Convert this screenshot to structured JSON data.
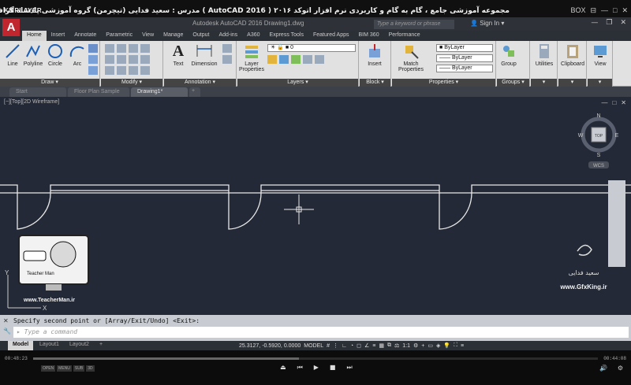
{
  "player": {
    "logo": "KMPLAYER",
    "title": "مجموعه آموزشی جامع ، گام به گام و کاربردی نرم افزار  اتوکد ۲۰۱۶ ( AutoCAD 2016 )  مدرس : سعید فدایی (تیچرمن) گروه آموزشی پادشاه گرافیست ها",
    "right_label": "BOX",
    "time_elapsed": "00:48:23",
    "time_total": "00:44:08",
    "progress": 0.47,
    "small_buttons": [
      "OPEN",
      "MENU",
      "SUB",
      "3D"
    ]
  },
  "acad": {
    "logo_letter": "A",
    "file_title": "Autodesk AutoCAD 2016   Drawing1.dwg",
    "search_placeholder": "Type a keyword or phrase",
    "sign_in": "Sign In",
    "ribbon_tabs": [
      "Home",
      "Insert",
      "Annotate",
      "Parametric",
      "View",
      "Manage",
      "Output",
      "Add-ins",
      "A360",
      "Express Tools",
      "Featured Apps",
      "BIM 360",
      "Performance"
    ],
    "active_tab": "Home",
    "draw_tools": [
      "Line",
      "Polyline",
      "Circle",
      "Arc"
    ],
    "panels": {
      "draw": "Draw",
      "modify": "Modify",
      "annotation": "Annotation",
      "layers": "Layers",
      "block": "Block",
      "properties": "Properties",
      "groups": "Groups"
    },
    "annotation_tools": [
      "Text",
      "Dimension"
    ],
    "layer_tool": "Layer Properties",
    "layer_value": "0",
    "insert_tool": "Insert",
    "match_tool": "Match Properties",
    "bylayer": "ByLayer",
    "group_tool": "Group",
    "utilities": "Utilities",
    "clipboard": "Clipboard",
    "view": "View",
    "doc_tabs": [
      "Start",
      "Floor Plan Sample",
      "Drawing1*"
    ],
    "viewport_label": "[−][Top][2D Wireframe]",
    "viewcube": {
      "top": "TOP",
      "n": "N",
      "s": "S",
      "e": "E",
      "w": "W",
      "wcs": "WCS"
    },
    "ucs": {
      "y": "Y",
      "x": "X"
    },
    "command_history": "Specify second point or [Array/Exit/Undo] <Exit>:",
    "command_placeholder": "Type a command",
    "layout_tabs": [
      "Model",
      "Layout1",
      "Layout2"
    ],
    "coords": "25.3127, -0.5920, 0.0000",
    "model_label": "MODEL",
    "scale": "1:1"
  },
  "watermark": {
    "teacher_site": "www.TeacherMan.ir",
    "teacher_caption": "Teacher Man",
    "gfx_site": "www.GfxKing.ir",
    "signature": "سعید فدایی"
  },
  "colors": {
    "viewport_bg": "#232936",
    "linework": "#e8e8e8",
    "ribbon_bg": "#e1e1e1",
    "autocad_red": "#c0262d"
  }
}
